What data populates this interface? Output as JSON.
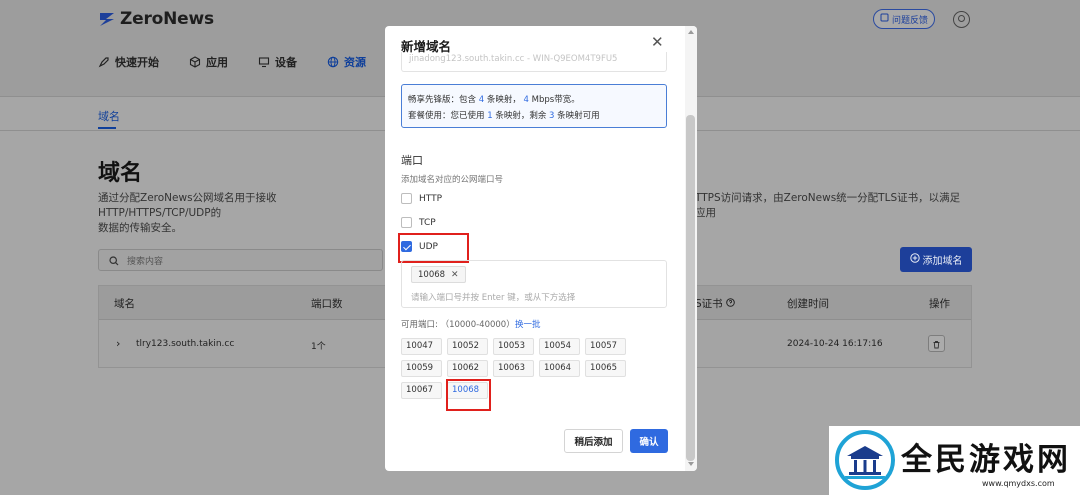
{
  "app": {
    "logo_text": "ZeroNews",
    "feedback_label": "问题反馈"
  },
  "nav": {
    "items": [
      {
        "label": "快速开始",
        "icon": "rocket-icon"
      },
      {
        "label": "应用",
        "icon": "cube-icon"
      },
      {
        "label": "设备",
        "icon": "monitor-icon"
      },
      {
        "label": "资源",
        "icon": "globe-icon",
        "active": true
      }
    ]
  },
  "subtab": {
    "label": "域名"
  },
  "page": {
    "title": "域名",
    "desc_left": "通过分配ZeroNews公网域名用于接收 HTTP/HTTPS/TCP/UDP的",
    "desc_left_2": "数据的传输安全。",
    "desc_right": "TTPS访问请求，由ZeroNews统一分配TLS证书，以满足应用",
    "search_placeholder": "搜索内容",
    "add_button": "添加域名"
  },
  "table": {
    "headers": [
      "域名",
      "端口数",
      "S证书",
      "创建时间",
      "操作"
    ],
    "rows": [
      {
        "domain": "tlry123.south.takin.cc",
        "ports": "1个",
        "created": "2024-10-24 16:17:16"
      }
    ]
  },
  "modal": {
    "title": "新增域名",
    "partial_field": "jinadong123.south.takin.cc - WIN-Q9EOM4T9FU5",
    "plan_line1": {
      "prefix": "畅享先锋版：包含 ",
      "num1": "4",
      "mid": " 条映射， ",
      "num2": "4",
      "suffix": " Mbps带宽。"
    },
    "plan_line2": {
      "prefix": "套餐使用：您已使用 ",
      "num1": "1",
      "mid": " 条映射，剩余 ",
      "num2": "3",
      "suffix": " 条映射可用"
    },
    "port_label": "端口",
    "port_help": "添加域名对应的公网端口号",
    "protocols": [
      {
        "label": "HTTP",
        "checked": false
      },
      {
        "label": "TCP",
        "checked": false
      },
      {
        "label": "UDP",
        "checked": true
      }
    ],
    "selected_port": "10068",
    "port_placeholder": "请输入端口号并按 Enter 键，或从下方选择",
    "available_label": "可用端口: （10000-40000）",
    "refresh_label": "换一批",
    "available_ports": [
      "10047",
      "10052",
      "10053",
      "10054",
      "10057",
      "10059",
      "10062",
      "10063",
      "10064",
      "10065",
      "10067",
      "10068"
    ],
    "selected_chip": "10068",
    "later_button": "稍后添加",
    "confirm_button": "确认"
  },
  "watermark": {
    "text": "全民游戏网",
    "url": "www.qmydxs.com"
  },
  "colors": {
    "accent": "#2f6ae0",
    "highlight_red": "#e0201c",
    "dim_accent": "#1d3f9a"
  }
}
